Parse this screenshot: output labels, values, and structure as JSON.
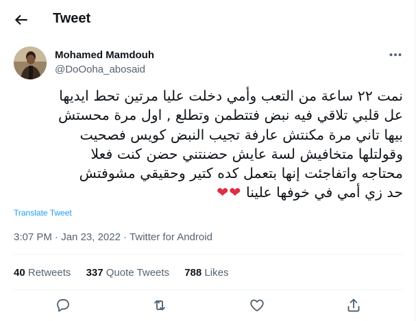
{
  "header": {
    "title": "Tweet"
  },
  "author": {
    "name": "Mohamed Mamdouh",
    "handle": "@DoOoha_abosaid"
  },
  "tweet": {
    "lines": [
      "نمت ٢٢ ساعة من التعب وأمي دخلت عليا مرتين تحط ايديها",
      "عل قلبي تلاقي فيه نبض فتتطمن وتطلع , اول مرة محستش",
      "بيها تاني مرة مكنتش عارفة تجيب النبض كويس فصحيت",
      "وقولتلها متخافيش لسة عايش حضنتني حضن كنت فعلا",
      "محتاجه واتفاجئت إنها بتعمل كده كتير وحقيقي مشوفتش",
      "حد زي أمي في خوفها علينا"
    ],
    "emoji": "❤❤",
    "translate_label": "Translate Tweet"
  },
  "meta": {
    "time": "3:07 PM",
    "separator": "·",
    "date": "Jan 23, 2022",
    "source": "Twitter for Android"
  },
  "stats": {
    "retweets_count": "40",
    "retweets_label": "Retweets",
    "quotes_count": "337",
    "quotes_label": "Quote Tweets",
    "likes_count": "788",
    "likes_label": "Likes"
  },
  "actions": [
    "reply-icon",
    "retweet-icon",
    "like-icon",
    "share-icon"
  ],
  "colors": {
    "text": "#0f1419",
    "secondary": "#536471",
    "link": "#1d9bf0",
    "divider": "#eff3f4",
    "heart": "#dd2e44"
  }
}
